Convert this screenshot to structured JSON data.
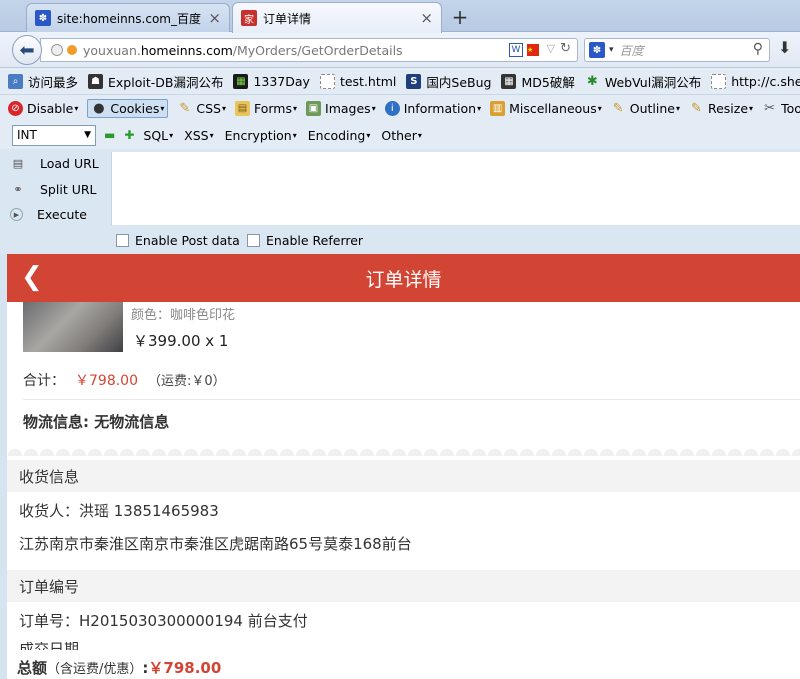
{
  "tabs": [
    {
      "title": "site:homeinns.com_百度...",
      "close": "×"
    },
    {
      "title": "订单详情",
      "close": "×"
    }
  ],
  "newtab": "+",
  "address": {
    "domain_prefix": "youxuan.",
    "domain": "homeinns.com",
    "path": "/MyOrders/GetOrderDetails"
  },
  "search": {
    "placeholder": "百度"
  },
  "bookmarks": [
    "访问最多",
    "Exploit-DB漏洞公布",
    "1337Day",
    "test.html",
    "国内SeBug",
    "MD5破解",
    "WebVul漏洞公布",
    "http://c.shellsec.com"
  ],
  "devbar": [
    "Disable",
    "Cookies",
    "CSS",
    "Forms",
    "Images",
    "Information",
    "Miscellaneous",
    "Outline",
    "Resize",
    "Tools"
  ],
  "hackbar": {
    "select": "INT",
    "menus": [
      "SQL",
      "XSS",
      "Encryption",
      "Encoding",
      "Other"
    ],
    "load": "Load URL",
    "split": "Split URL",
    "execute": "Execute",
    "post": "Enable Post data",
    "referrer": "Enable Referrer"
  },
  "page": {
    "title": "订单详情",
    "back": "❮",
    "color": "颜色：咖啡色印花",
    "price": "￥399.00 x 1",
    "total_label": "合计：",
    "total_value": "￥798.00",
    "shipping": "（运费:￥0）",
    "logistics": "物流信息: 无物流信息",
    "recv_head": "收货信息",
    "recv_person": "收货人：洪瑶 13851465983",
    "recv_address": "江苏南京市秦淮区南京市秦淮区虎踞南路65号莫泰168前台",
    "order_head": "订单编号",
    "order_no": "订单号：H2015030300000194 前台支付",
    "cut": "成交日期",
    "footer_label": "总额",
    "footer_note": "（含运费/优惠）",
    "footer_colon": ":",
    "footer_value": "￥798.00"
  },
  "colors": {
    "header": "#d24535",
    "accent_red": "#d24535"
  }
}
